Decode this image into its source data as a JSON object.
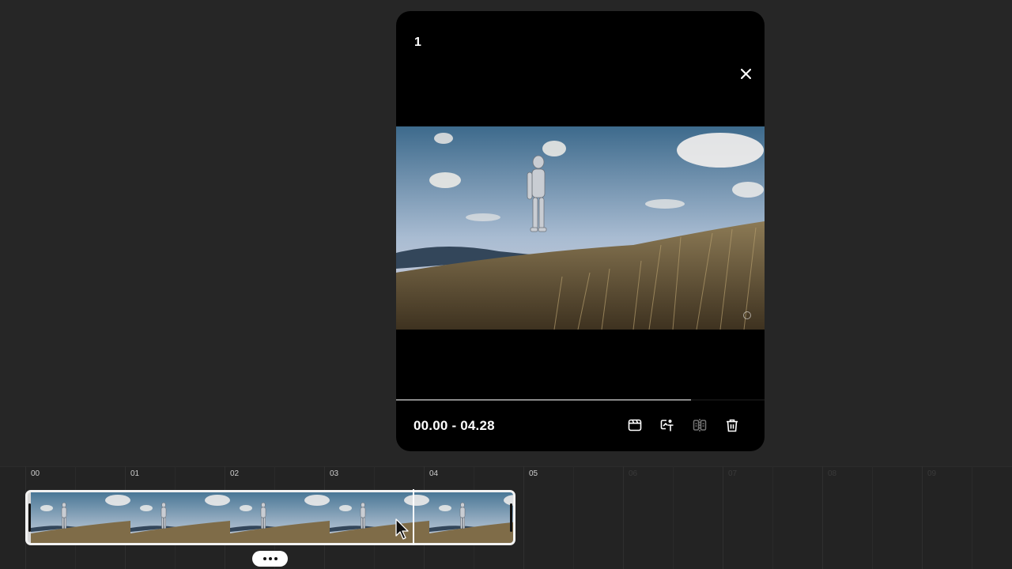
{
  "preview": {
    "clip_index": "1",
    "time_range": "00.00 - 04.28",
    "progress_fraction": 0.8,
    "tools": [
      {
        "name": "scene-icon",
        "label": "Scene",
        "enabled": true
      },
      {
        "name": "text-effect-icon",
        "label": "Text effect",
        "enabled": true
      },
      {
        "name": "split-icon",
        "label": "Split",
        "enabled": false
      },
      {
        "name": "trash-icon",
        "label": "Delete",
        "enabled": true
      }
    ]
  },
  "timeline": {
    "ticks": [
      "00",
      "01",
      "02",
      "03",
      "04",
      "05",
      "06",
      "07",
      "08",
      "09"
    ],
    "active_tick_count": 6,
    "clip_seconds": 4.28,
    "playhead_seconds": 3.9
  },
  "colors": {
    "background": "#262626",
    "card": "#000000",
    "clip_border": "#f2f2f2",
    "sky_top": "#3f6e8f",
    "sky_bottom": "#c9d2e0",
    "grass": "#7a6440"
  }
}
